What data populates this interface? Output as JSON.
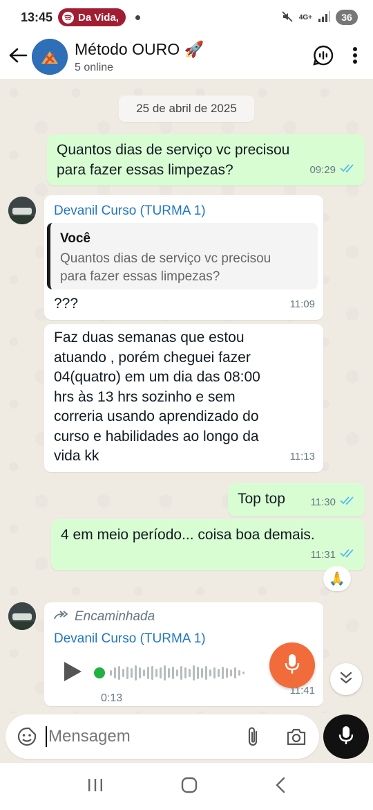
{
  "status_bar": {
    "time": "13:45",
    "spotify_label": "Da Vida, ",
    "network_label": "4G+",
    "battery": "36"
  },
  "header": {
    "title": "Método OURO 🚀",
    "subtitle": "5 online"
  },
  "chat": {
    "date_chip": "25 de abril de 2025",
    "messages": [
      {
        "direction": "out",
        "text_lines": [
          "Quantos dias de serviço vc precisou",
          "para fazer essas limpezas?"
        ],
        "time": "09:29",
        "read": true
      },
      {
        "direction": "in",
        "sender": "Devanil Curso (TURMA 1)",
        "quote_author": "Você",
        "quote_lines": [
          "Quantos dias de serviço vc precisou",
          "para fazer essas limpezas?"
        ],
        "text": "???",
        "time": "11:09"
      },
      {
        "direction": "in",
        "text_lines": [
          "Faz duas semanas que estou",
          "atuando , porém cheguei fazer",
          "04(quatro) em um dia das 08:00",
          "hrs às 13 hrs sozinho e sem",
          "correria usando aprendizado do",
          "curso e habilidades ao longo da",
          "vida kk"
        ],
        "time": "11:13"
      },
      {
        "direction": "out",
        "text": "Top top",
        "time": "11:30",
        "read": true
      },
      {
        "direction": "out",
        "text": "4 em meio período... coisa boa demais.",
        "time": "11:31",
        "read": true,
        "reaction": "🙏"
      },
      {
        "direction": "in",
        "forwarded_label": "Encaminhada",
        "sender": "Devanil Curso (TURMA 1)",
        "voice_duration": "0:13",
        "time": "11:41"
      }
    ]
  },
  "composer": {
    "placeholder": "Mensagem"
  },
  "colors": {
    "outgoing_bubble": "#d9fdd3",
    "incoming_bubble": "#ffffff",
    "sender_name": "#1f76c2",
    "read_ticks": "#53bdeb",
    "record_button": "#f26b3a",
    "chat_background": "#efeae2"
  },
  "icons": [
    "back-arrow-icon",
    "voice-chat-icon",
    "more-options-icon",
    "double-check-icon",
    "play-icon",
    "forward-icon",
    "microphone-icon",
    "chevrons-down-icon",
    "emoji-sticker-icon",
    "attach-icon",
    "camera-icon",
    "nav-recents-icon",
    "nav-home-icon",
    "nav-back-icon"
  ]
}
